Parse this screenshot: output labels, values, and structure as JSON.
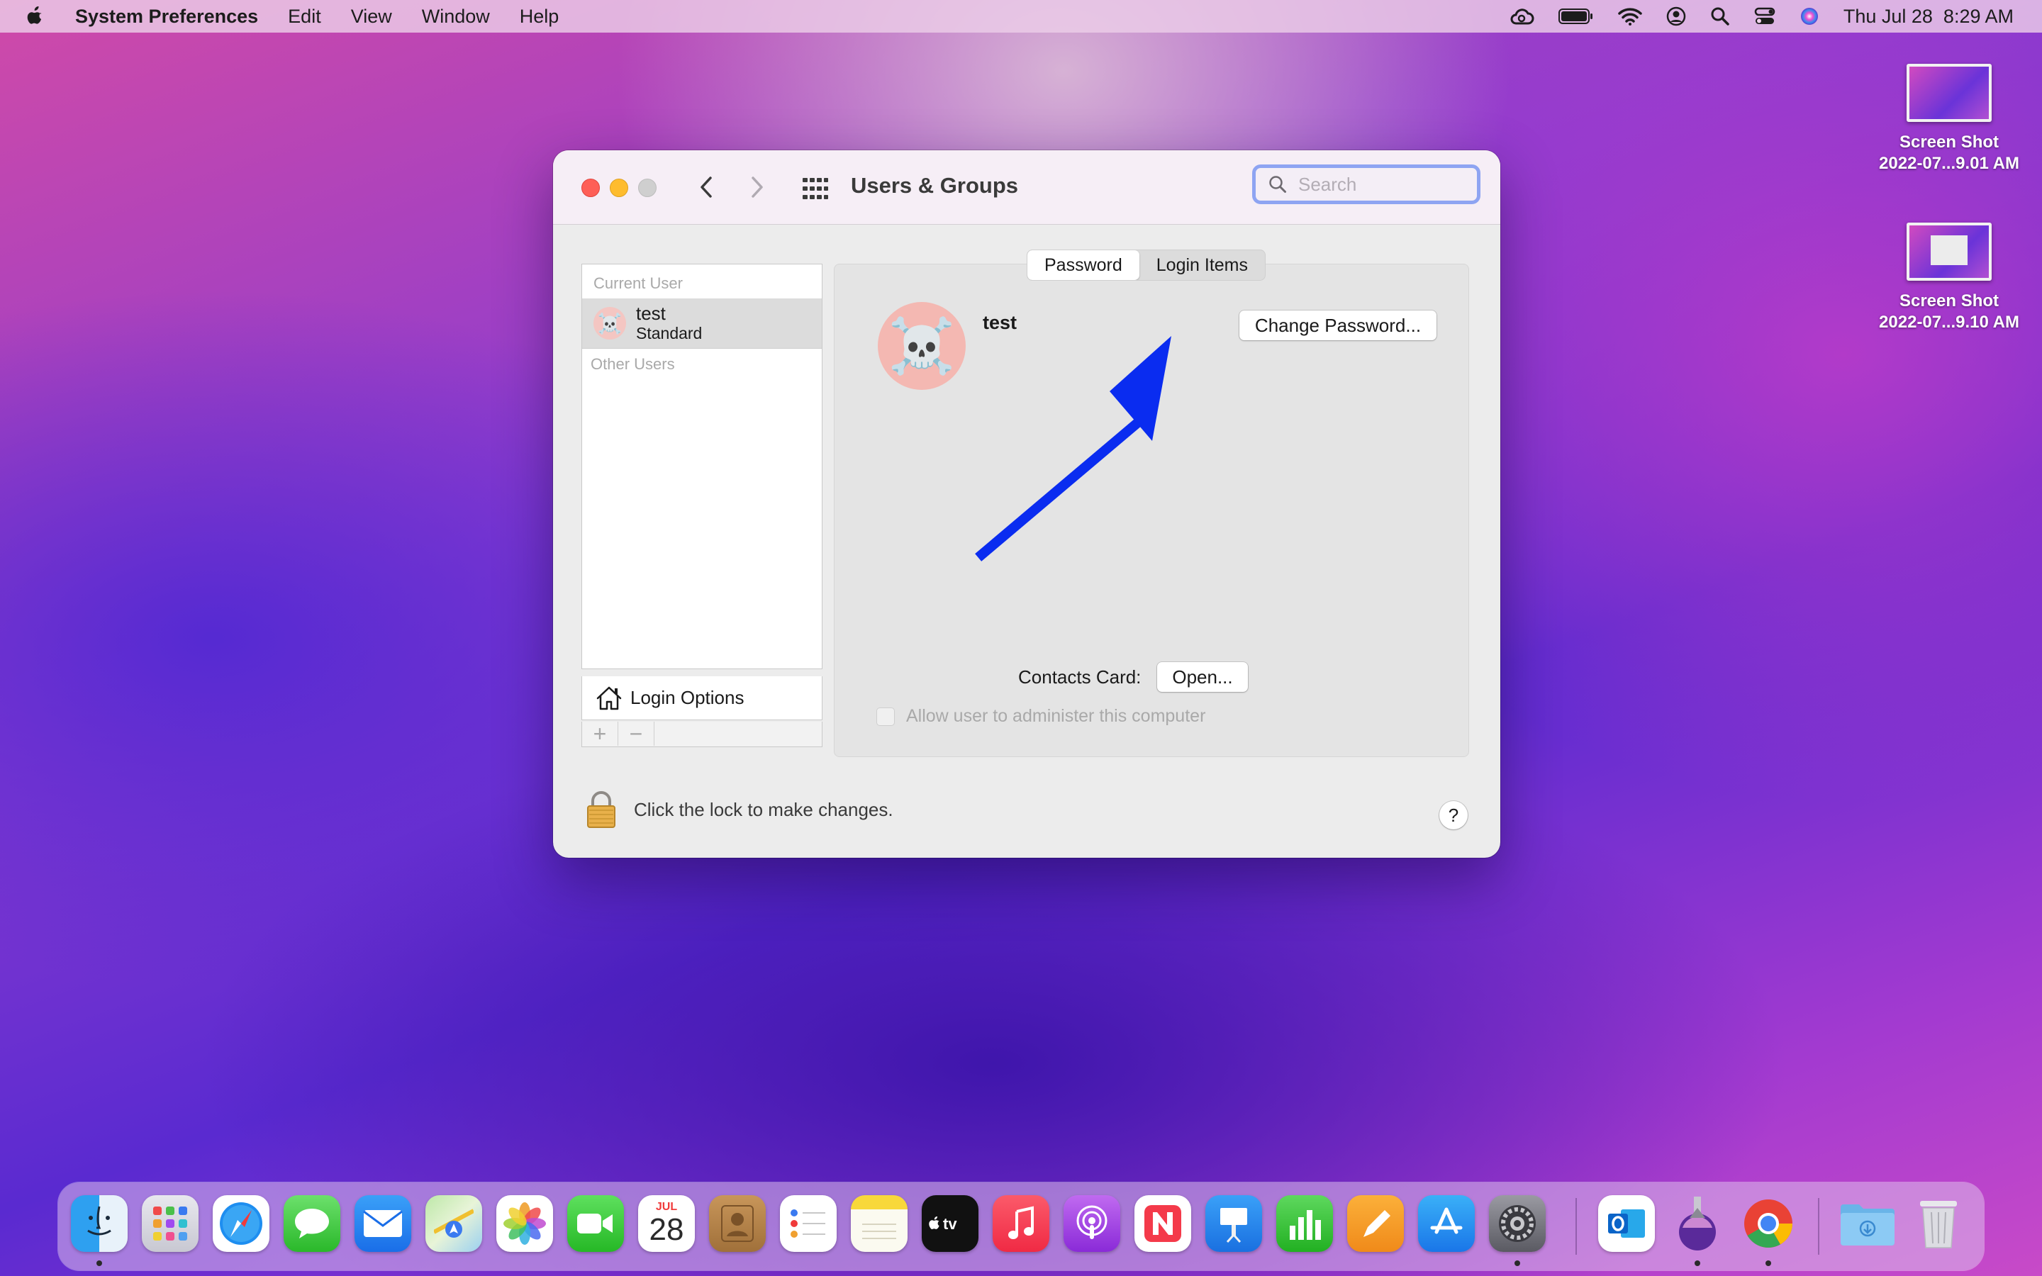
{
  "menubar": {
    "app_name": "System Preferences",
    "menus": [
      "Edit",
      "View",
      "Window",
      "Help"
    ],
    "datetime": "Thu Jul 28  8:29 AM",
    "status_icons": [
      "creative-cloud-icon",
      "battery-icon",
      "wifi-icon",
      "user-account-icon",
      "spotlight-icon",
      "control-center-icon",
      "siri-icon"
    ]
  },
  "desktop": {
    "items": [
      {
        "line1": "Screen Shot",
        "line2": "2022-07...9.01 AM"
      },
      {
        "line1": "Screen Shot",
        "line2": "2022-07...9.10 AM"
      }
    ]
  },
  "window": {
    "title": "Users & Groups",
    "search_placeholder": "Search",
    "sidebar": {
      "current_user_label": "Current User",
      "current_user": {
        "name": "test",
        "role": "Standard",
        "avatar": "☠️"
      },
      "other_users_label": "Other Users",
      "login_options_label": "Login Options",
      "add_label": "+",
      "remove_label": "−"
    },
    "detail": {
      "tabs": [
        {
          "label": "Password",
          "active": true
        },
        {
          "label": "Login Items",
          "active": false
        }
      ],
      "user_name": "test",
      "avatar": "☠️",
      "change_password_label": "Change Password...",
      "contacts_card_label": "Contacts Card:",
      "open_label": "Open...",
      "admin_checkbox_label": "Allow user to administer this computer",
      "admin_checked": false
    },
    "lock_text": "Click the lock to make changes.",
    "help_label": "?"
  },
  "annotation": {
    "arrow_color": "#0a2cf0"
  },
  "dock": {
    "calendar_month": "JUL",
    "calendar_day": "28",
    "apps": [
      "finder",
      "launchpad",
      "safari",
      "messages",
      "mail",
      "maps",
      "photos",
      "facetime",
      "calendar",
      "contacts",
      "reminders",
      "notes",
      "tv",
      "music",
      "podcasts",
      "news",
      "keynote",
      "numbers",
      "pages",
      "app-store",
      "system-preferences",
      "outlook",
      "mirror-app",
      "chrome",
      "downloads",
      "trash"
    ]
  }
}
